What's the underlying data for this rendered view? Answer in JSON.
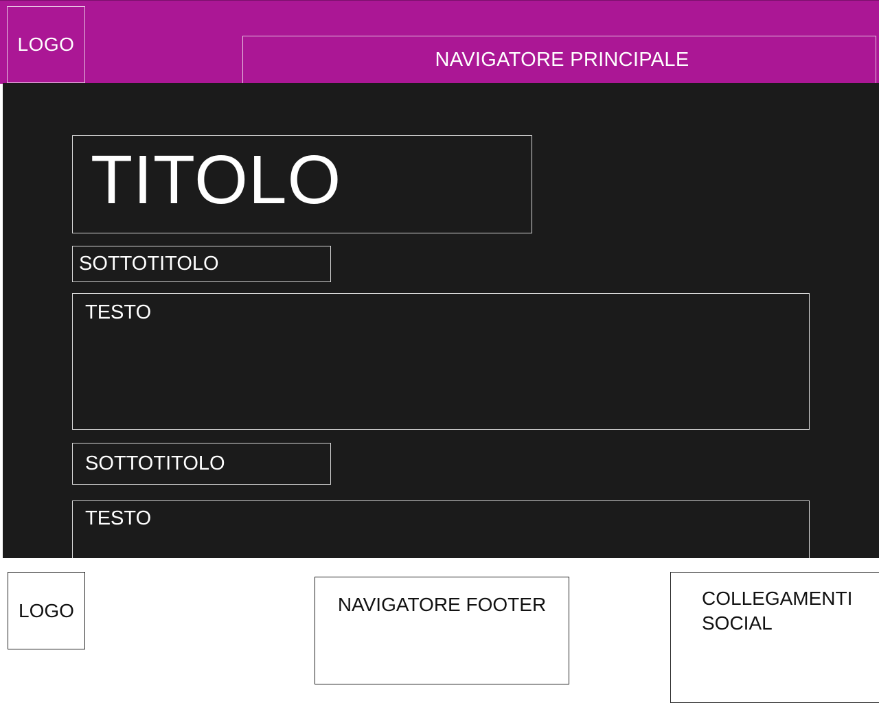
{
  "header": {
    "logo_label": "LOGO",
    "main_nav_label": "NAVIGATORE PRINCIPALE"
  },
  "content": {
    "title": "TITOLO",
    "sections": [
      {
        "subtitle": "SOTTOTITOLO",
        "text": "TESTO"
      },
      {
        "subtitle": "SOTTOTITOLO",
        "text": "TESTO"
      }
    ]
  },
  "footer": {
    "logo_label": "LOGO",
    "nav_label": "NAVIGATORE FOOTER",
    "social_line1": "COLLEGAMENTI",
    "social_line2": "SOCIAL"
  },
  "colors": {
    "header_bg": "#ab1795",
    "content_bg": "#1b1b1b",
    "footer_bg": "#ffffff"
  }
}
